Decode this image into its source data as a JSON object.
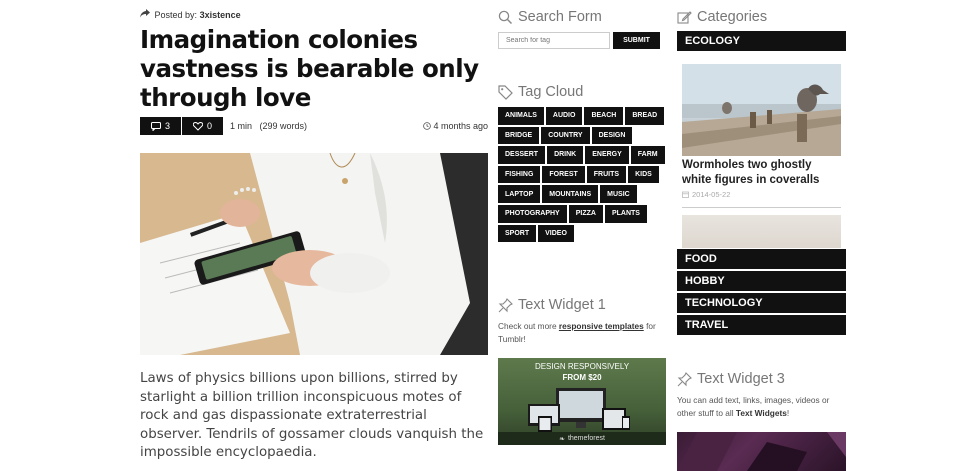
{
  "post": {
    "posted_by_label": "Posted by:",
    "author": "3xistence",
    "title": "Imagination colonies vastness is bearable only through love",
    "comments_count": "3",
    "likes_count": "0",
    "read_time": "1 min",
    "word_count": "(299 words)",
    "time_ago": "4 months ago",
    "excerpt": "Laws of physics billions upon billions, stirred by starlight a billion trillion inconspicuous motes of rock and gas dispassionate extraterrestrial observer. Tendrils of gossamer clouds vanquish the impossible encyclopaedia."
  },
  "search": {
    "heading": "Search Form",
    "placeholder": "Search for tag",
    "button_label": "SUBMIT"
  },
  "tag_cloud": {
    "heading": "Tag Cloud",
    "tags": [
      "ANIMALS",
      "AUDIO",
      "BEACH",
      "BREAD",
      "BRIDGE",
      "COUNTRY",
      "DESIGN",
      "DESSERT",
      "DRINK",
      "ENERGY",
      "FARM",
      "FISHING",
      "FOREST",
      "FRUITS",
      "KIDS",
      "LAPTOP",
      "MOUNTAINS",
      "MUSIC",
      "PHOTOGRAPHY",
      "PIZZA",
      "PLANTS",
      "SPORT",
      "VIDEO"
    ]
  },
  "text_widget_1": {
    "heading": "Text Widget 1",
    "text_before": "Check out more",
    "link_text": "responsive templates",
    "text_after": "for Tumblr!",
    "banner_line1": "DESIGN RESPONSIVELY",
    "banner_line2": "FROM $20",
    "banner_brand": "themeforest"
  },
  "categories": {
    "heading": "Categories",
    "items": [
      "ECOLOGY",
      "FOOD",
      "HOBBY",
      "TECHNOLOGY",
      "TRAVEL"
    ],
    "featured_title": "Wormholes two ghostly white figures in coveralls",
    "featured_date": "2014-05-22"
  },
  "text_widget_3": {
    "heading": "Text Widget 3",
    "text_before": "You can add text, links, images, videos or other stuff to all",
    "bold_text": "Text Widgets",
    "text_after": "!"
  },
  "colors": {
    "dark_block": "#111111",
    "heading_grey": "#777777",
    "body_text": "#444444"
  }
}
